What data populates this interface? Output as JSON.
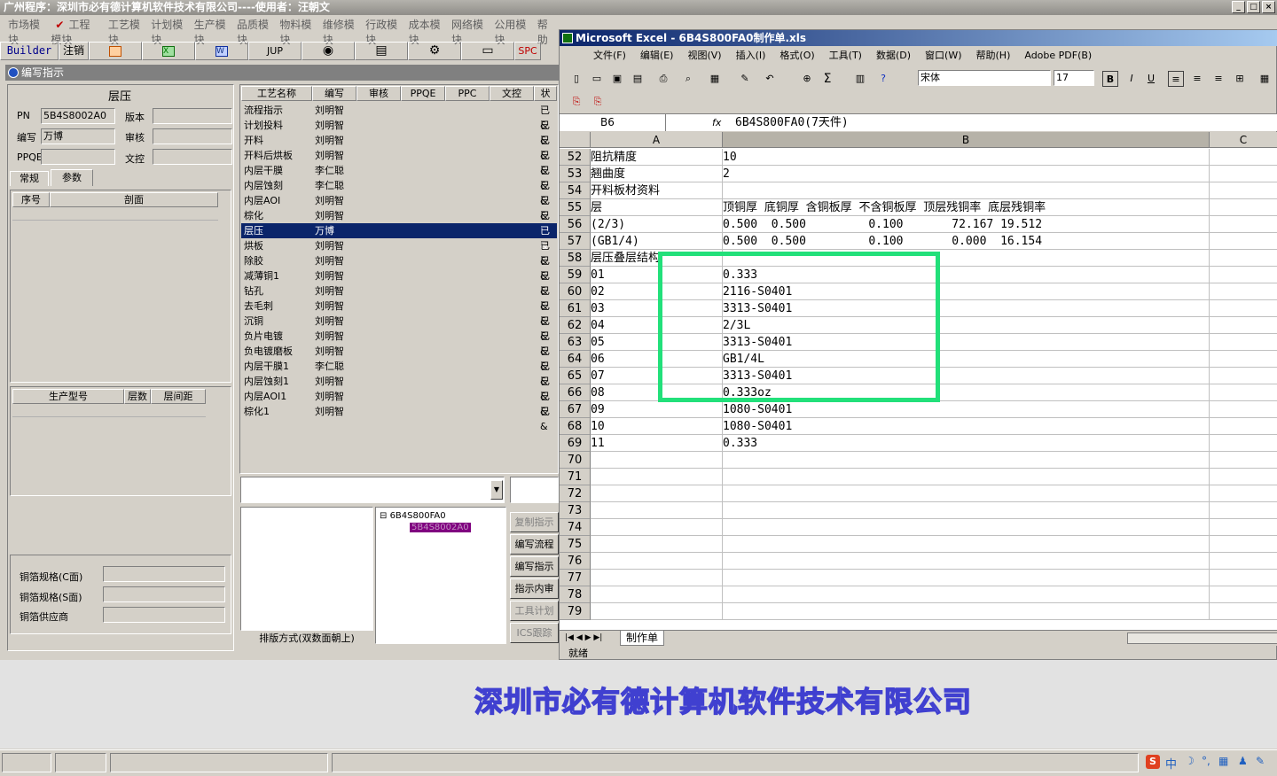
{
  "app": {
    "title": "广州程序：深圳市必有德计算机软件技术有限公司----使用者：汪朝文",
    "win_buttons": [
      "_",
      "□",
      "×"
    ]
  },
  "menu": [
    "市场模块",
    "工程模块",
    "工艺模块",
    "计划模块",
    "生产模块",
    "品质模块",
    "物料模块",
    "维修模块",
    "行政模块",
    "成本模块",
    "网络模块",
    "公用模块",
    "帮助"
  ],
  "toolbar": {
    "builder": "Builder",
    "logout": "注销",
    "jup": "JUP",
    "spc": "SPC"
  },
  "subwindow": {
    "title": "编写指示"
  },
  "left": {
    "section_title": "层压",
    "pn_label": "PN",
    "pn_value": "5B4S8002A0",
    "version_label": "版本",
    "version_value": "",
    "author_label": "编写",
    "author_value": "万博",
    "review_label": "审核",
    "review_value": "",
    "ppqe_label": "PPQE",
    "ppqe_value": "",
    "doc_label": "文控",
    "doc_value": "",
    "tab_general": "常规",
    "tab_params": "参数",
    "col_seq": "序号",
    "col_section": "剖面",
    "col_model": "生产型号",
    "col_layers": "层数",
    "col_spacing": "层间距",
    "copper_c_label": "铜箔规格(C面)",
    "copper_s_label": "铜箔规格(S面)",
    "copper_supplier_label": "铜箔供应商"
  },
  "process_table": {
    "headers": [
      "工艺名称",
      "编写",
      "审核",
      "PPQE",
      "PPC",
      "文控",
      "状"
    ],
    "rows": [
      [
        "流程指示",
        "刘明智",
        "已&"
      ],
      [
        "计划投料",
        "刘明智",
        "已&"
      ],
      [
        "开料",
        "刘明智",
        "已&"
      ],
      [
        "开料后烘板",
        "刘明智",
        "已&"
      ],
      [
        "内层干膜",
        "李仁聪",
        "已&"
      ],
      [
        "内层蚀刻",
        "李仁聪",
        "已&"
      ],
      [
        "内层AOI",
        "刘明智",
        "已&"
      ],
      [
        "棕化",
        "刘明智",
        "已&"
      ],
      [
        "层压",
        "万博",
        "已&"
      ],
      [
        "烘板",
        "刘明智",
        "已&"
      ],
      [
        "除胶",
        "刘明智",
        "已&"
      ],
      [
        "减薄铜1",
        "刘明智",
        "已&"
      ],
      [
        "钻孔",
        "刘明智",
        "已&"
      ],
      [
        "去毛刺",
        "刘明智",
        "已&"
      ],
      [
        "沉铜",
        "刘明智",
        "已&"
      ],
      [
        "负片电镀",
        "刘明智",
        "已&"
      ],
      [
        "负电镀磨板",
        "刘明智",
        "已&"
      ],
      [
        "内层干膜1",
        "李仁聪",
        "已&"
      ],
      [
        "内层蚀刻1",
        "刘明智",
        "已&"
      ],
      [
        "内层AOI1",
        "刘明智",
        "已&"
      ],
      [
        "棕化1",
        "刘明智",
        "已&"
      ]
    ],
    "selected_index": 8
  },
  "tree": {
    "root": "6B4S800FA0",
    "child": "5B4S8002A0"
  },
  "side_buttons": [
    "复制指示",
    "编写流程",
    "编写指示",
    "指示内审",
    "工具计划",
    "ICS跟踪"
  ],
  "layout_mode": "排版方式(双数面朝上)",
  "excel": {
    "title": "Microsoft Excel - 6B4S800FA0制作单.xls",
    "menu": [
      "文件(F)",
      "编辑(E)",
      "视图(V)",
      "插入(I)",
      "格式(O)",
      "工具(T)",
      "数据(D)",
      "窗口(W)",
      "帮助(H)",
      "Adobe PDF(B)"
    ],
    "font_name": "宋体",
    "font_size": "17",
    "name_box": "B6",
    "fx_label": "fx",
    "formula": "6B4S800FA0(7天件)",
    "columns": [
      "A",
      "B",
      "C"
    ],
    "rows": [
      {
        "n": "52",
        "a": "阻抗精度",
        "b": "10"
      },
      {
        "n": "53",
        "a": "翘曲度",
        "b": "2"
      },
      {
        "n": "54",
        "a": "开料板材资料",
        "b": ""
      },
      {
        "n": "55",
        "a": "层",
        "b": "顶铜厚 底铜厚 含铜板厚 不含铜板厚 顶层残铜率 底层残铜率"
      },
      {
        "n": "56",
        "a": "(2/3)",
        "b": "0.500  0.500         0.100       72.167 19.512"
      },
      {
        "n": "57",
        "a": "(GB1/4)",
        "b": "0.500  0.500         0.100       0.000  16.154"
      },
      {
        "n": "58",
        "a": "层压叠层结构",
        "b": ""
      },
      {
        "n": "59",
        "a": "01",
        "b": "0.333"
      },
      {
        "n": "60",
        "a": "02",
        "b": "2116-S0401"
      },
      {
        "n": "61",
        "a": "03",
        "b": "3313-S0401"
      },
      {
        "n": "62",
        "a": "04",
        "b": "2/3L"
      },
      {
        "n": "63",
        "a": "05",
        "b": "3313-S0401"
      },
      {
        "n": "64",
        "a": "06",
        "b": "GB1/4L"
      },
      {
        "n": "65",
        "a": "07",
        "b": "3313-S0401"
      },
      {
        "n": "66",
        "a": "08",
        "b": "0.333oz"
      },
      {
        "n": "67",
        "a": "09",
        "b": "1080-S0401"
      },
      {
        "n": "68",
        "a": "10",
        "b": "1080-S0401"
      },
      {
        "n": "69",
        "a": "11",
        "b": "0.333"
      },
      {
        "n": "70",
        "a": "",
        "b": ""
      },
      {
        "n": "71",
        "a": "",
        "b": ""
      },
      {
        "n": "72",
        "a": "",
        "b": ""
      },
      {
        "n": "73",
        "a": "",
        "b": ""
      },
      {
        "n": "74",
        "a": "",
        "b": ""
      },
      {
        "n": "75",
        "a": "",
        "b": ""
      },
      {
        "n": "76",
        "a": "",
        "b": ""
      },
      {
        "n": "77",
        "a": "",
        "b": ""
      },
      {
        "n": "78",
        "a": "",
        "b": ""
      },
      {
        "n": "79",
        "a": "",
        "b": ""
      }
    ],
    "sheet_tab": "制作单",
    "status": "就绪"
  },
  "banner": "深圳市必有德计算机软件技术有限公司",
  "tray": {
    "ime": "中",
    "highlight_color": "#22e07a"
  }
}
